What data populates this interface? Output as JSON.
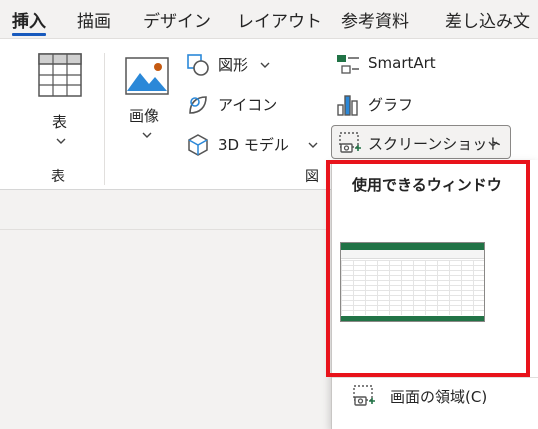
{
  "tabs": [
    {
      "label": "挿入",
      "active": true
    },
    {
      "label": "描画"
    },
    {
      "label": "デザイン"
    },
    {
      "label": "レイアウト"
    },
    {
      "label": "参考資料"
    },
    {
      "label": "差し込み文"
    }
  ],
  "ribbon": {
    "table": {
      "button_label": "表",
      "group_label": "表"
    },
    "image": {
      "button_label": "画像"
    },
    "shapes": {
      "label": "図形"
    },
    "icons": {
      "label": "アイコン"
    },
    "models3d": {
      "label": "3D モデル"
    },
    "smartart": {
      "label": "SmartArt"
    },
    "graph": {
      "label": "グラフ"
    },
    "screenshot": {
      "label": "スクリーンショット"
    },
    "illustrations_group_label": "図"
  },
  "dropdown": {
    "header": "使用できるウィンドウ",
    "clip_label": "画面の領域(C)"
  },
  "colors": {
    "accent": "#185abd",
    "highlight": "#e8131b",
    "excel_green": "#217346"
  }
}
